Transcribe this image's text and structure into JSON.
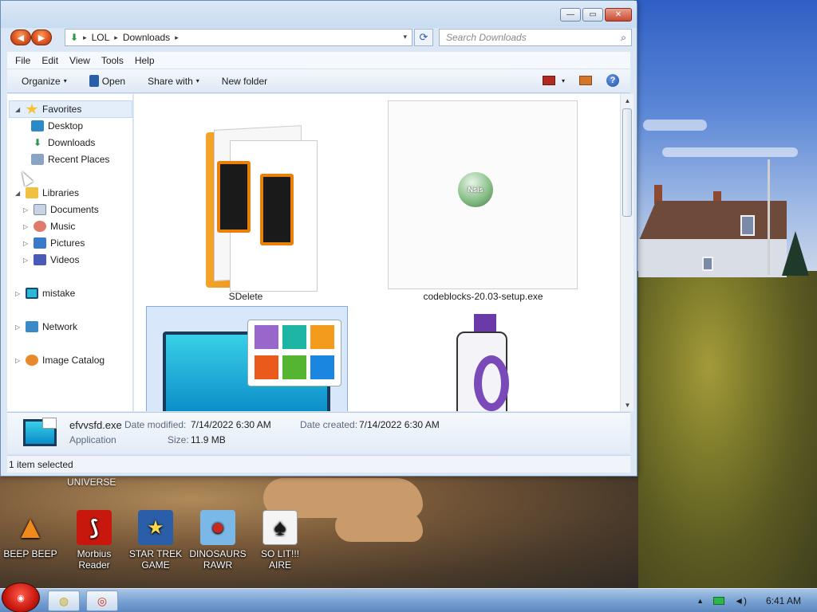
{
  "window": {
    "controls": {
      "minimize": "—",
      "maximize": "▭",
      "close": "✕"
    }
  },
  "address_bar": {
    "back_icon": "◀",
    "forward_icon": "▶",
    "location_icon": "⬇",
    "crumbs": [
      "LOL",
      "Downloads"
    ],
    "separator": "▸",
    "dropdown": "▾",
    "refresh_icon": "⟳"
  },
  "search": {
    "placeholder": "Search Downloads",
    "icon": "⌕"
  },
  "menubar": {
    "items": [
      "File",
      "Edit",
      "View",
      "Tools",
      "Help"
    ]
  },
  "toolbar": {
    "organize": "Organize",
    "open": "Open",
    "share_with": "Share with",
    "new_folder": "New folder",
    "caret": "▾",
    "view_caret": "▾",
    "help_glyph": "?"
  },
  "navigation": {
    "expand_open": "◢",
    "expand_closed": "▷",
    "favorites": {
      "label": "Favorites",
      "items": [
        "Desktop",
        "Downloads",
        "Recent Places"
      ]
    },
    "libraries": {
      "label": "Libraries",
      "items": [
        "Documents",
        "Music",
        "Pictures",
        "Videos"
      ]
    },
    "computer": "mistake",
    "network": "Network",
    "image_catalog": "Image Catalog"
  },
  "files": [
    {
      "name": "SDelete"
    },
    {
      "name": "codeblocks-20.03-setup.exe",
      "badge": "Nsis"
    },
    {
      "name": "efvvsfd.exe",
      "selected": true
    },
    {
      "name": ""
    }
  ],
  "tile_colors": [
    "#9966cc",
    "#1fb5a5",
    "#f29b1d",
    "#e95a1b",
    "#55b530",
    "#1a86e0"
  ],
  "scrollbar": {
    "up": "▲",
    "down": "▼"
  },
  "details": {
    "name": "efvvsfd.exe",
    "type": "Application",
    "modified_label": "Date modified:",
    "modified": "7/14/2022 6:30 AM",
    "created_label": "Date created:",
    "created": "7/14/2022 6:30 AM",
    "size_label": "Size:",
    "size": "11.9 MB"
  },
  "status": {
    "text": "1 item selected"
  },
  "desktop": {
    "partial_label": "UNIVERSE",
    "icons": [
      {
        "label": "BEEP BEEP",
        "glyph": "▲",
        "color": "#f08a1a"
      },
      {
        "label": "Morbius Reader",
        "glyph": "⟆",
        "color": "#c8180e"
      },
      {
        "label": "STAR TREK GAME",
        "glyph": "★",
        "color": "#2a5ea8"
      },
      {
        "label": "DINOSAURS RAWR",
        "glyph": "●",
        "color": "#c8281e"
      },
      {
        "label": "SO LIT!!! AIRE",
        "glyph": "♠",
        "color": "#f4f4f4"
      }
    ]
  },
  "taskbar": {
    "start_glyph": "◉",
    "pinned": [
      {
        "name": "explorer",
        "glyph": "◍"
      },
      {
        "name": "chrome",
        "glyph": "◎"
      }
    ],
    "tray_arrow": "▲",
    "volume_icon": "◄)",
    "clock": "6:41 AM"
  }
}
